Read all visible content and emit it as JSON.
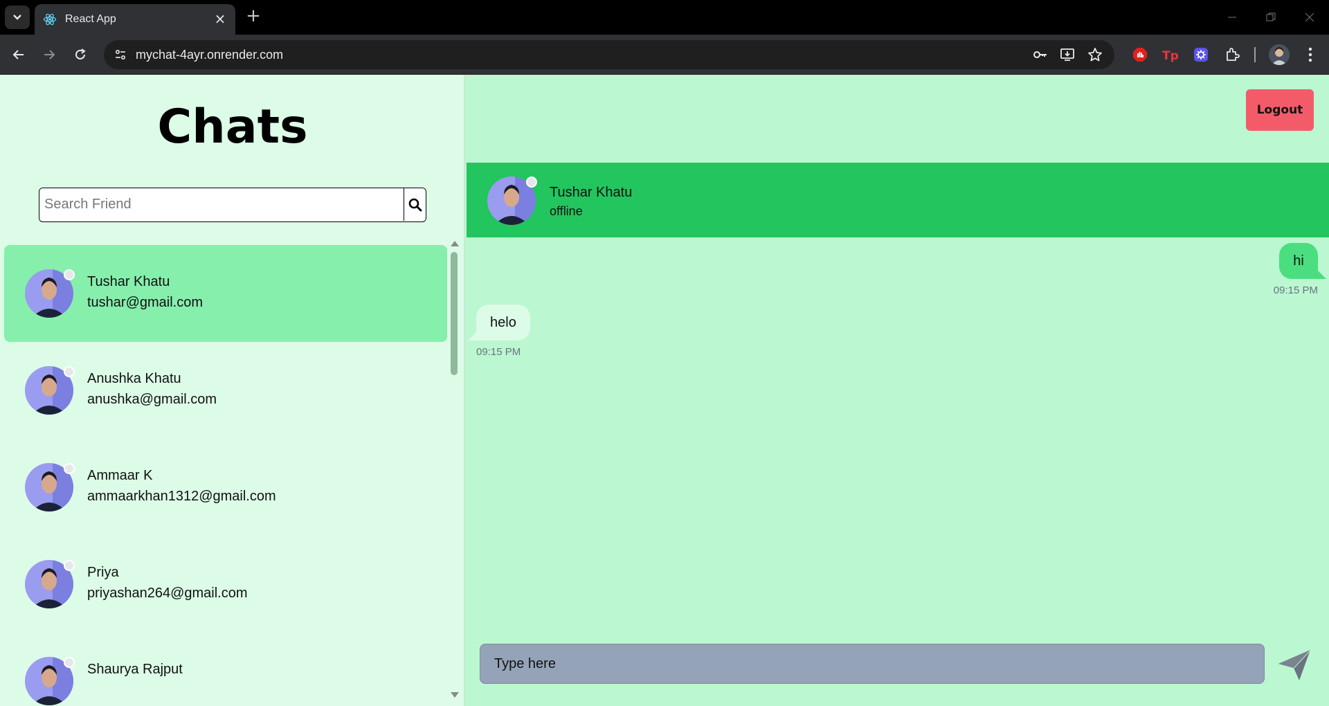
{
  "browser": {
    "tab_title": "React App",
    "url": "mychat-4ayr.onrender.com"
  },
  "sidebar": {
    "title": "Chats",
    "search_placeholder": "Search Friend",
    "contacts": [
      {
        "name": "Tushar Khatu",
        "email": "tushar@gmail.com",
        "active": true
      },
      {
        "name": "Anushka Khatu",
        "email": "anushka@gmail.com",
        "active": false
      },
      {
        "name": "Ammaar K",
        "email": "ammaarkhan1312@gmail.com",
        "active": false
      },
      {
        "name": "Priya",
        "email": "priyashan264@gmail.com",
        "active": false
      },
      {
        "name": "Shaurya Rajput",
        "email": "",
        "active": false
      }
    ]
  },
  "chat": {
    "logout_label": "Logout",
    "header": {
      "name": "Tushar Khatu",
      "status": "offline"
    },
    "messages": [
      {
        "text": "hi",
        "time": "09:15 PM",
        "direction": "outgoing"
      },
      {
        "text": "helo",
        "time": "09:15 PM",
        "direction": "incoming"
      }
    ],
    "input_placeholder": "Type here"
  },
  "colors": {
    "sidebar_bg": "#dcfce7",
    "main_bg": "#bbf7d0",
    "active_contact": "#86efac",
    "header_bg": "#22c55e",
    "outgoing_bubble": "#4ade80",
    "logout_bg": "#f45b69",
    "input_bg": "#94a3b8"
  }
}
